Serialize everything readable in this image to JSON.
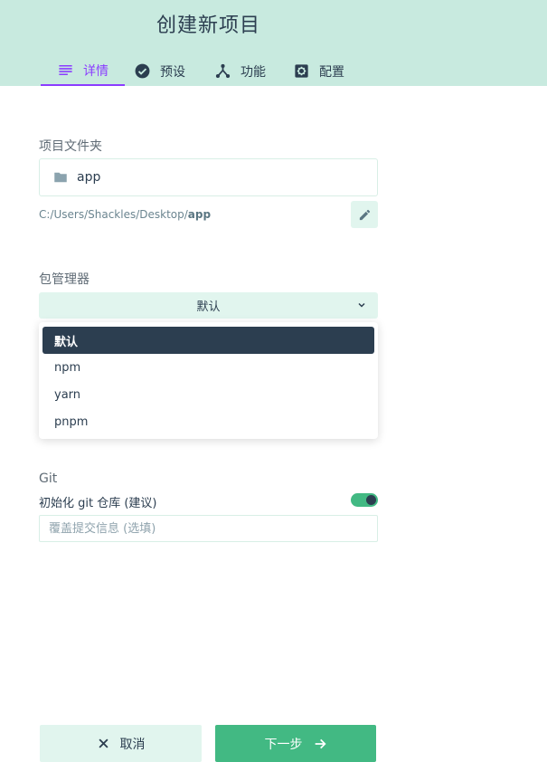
{
  "header": {
    "title": "创建新项目",
    "tabs": [
      {
        "label": "详情",
        "icon": "list-icon",
        "active": true
      },
      {
        "label": "预设",
        "icon": "check-circle-icon",
        "active": false
      },
      {
        "label": "功能",
        "icon": "fork-icon",
        "active": false
      },
      {
        "label": "配置",
        "icon": "gear-icon",
        "active": false
      }
    ]
  },
  "folder": {
    "label": "项目文件夹",
    "value": "app",
    "path_prefix": "C:/Users/Shackles/Desktop/",
    "path_name": "app"
  },
  "package_manager": {
    "label": "包管理器",
    "selected": "默认",
    "options": [
      "默认",
      "npm",
      "yarn",
      "pnpm"
    ]
  },
  "git": {
    "label": "Git",
    "init_label": "初始化 git 仓库 (建议)",
    "init_enabled": true,
    "commit_placeholder": "覆盖提交信息 (选填)",
    "commit_value": ""
  },
  "actions": {
    "cancel_label": "取消",
    "next_label": "下一步"
  },
  "colors": {
    "header_bg": "#c8eadf",
    "accent": "#42b983",
    "active_tab": "#8b3dff",
    "dark": "#2c3e50"
  }
}
